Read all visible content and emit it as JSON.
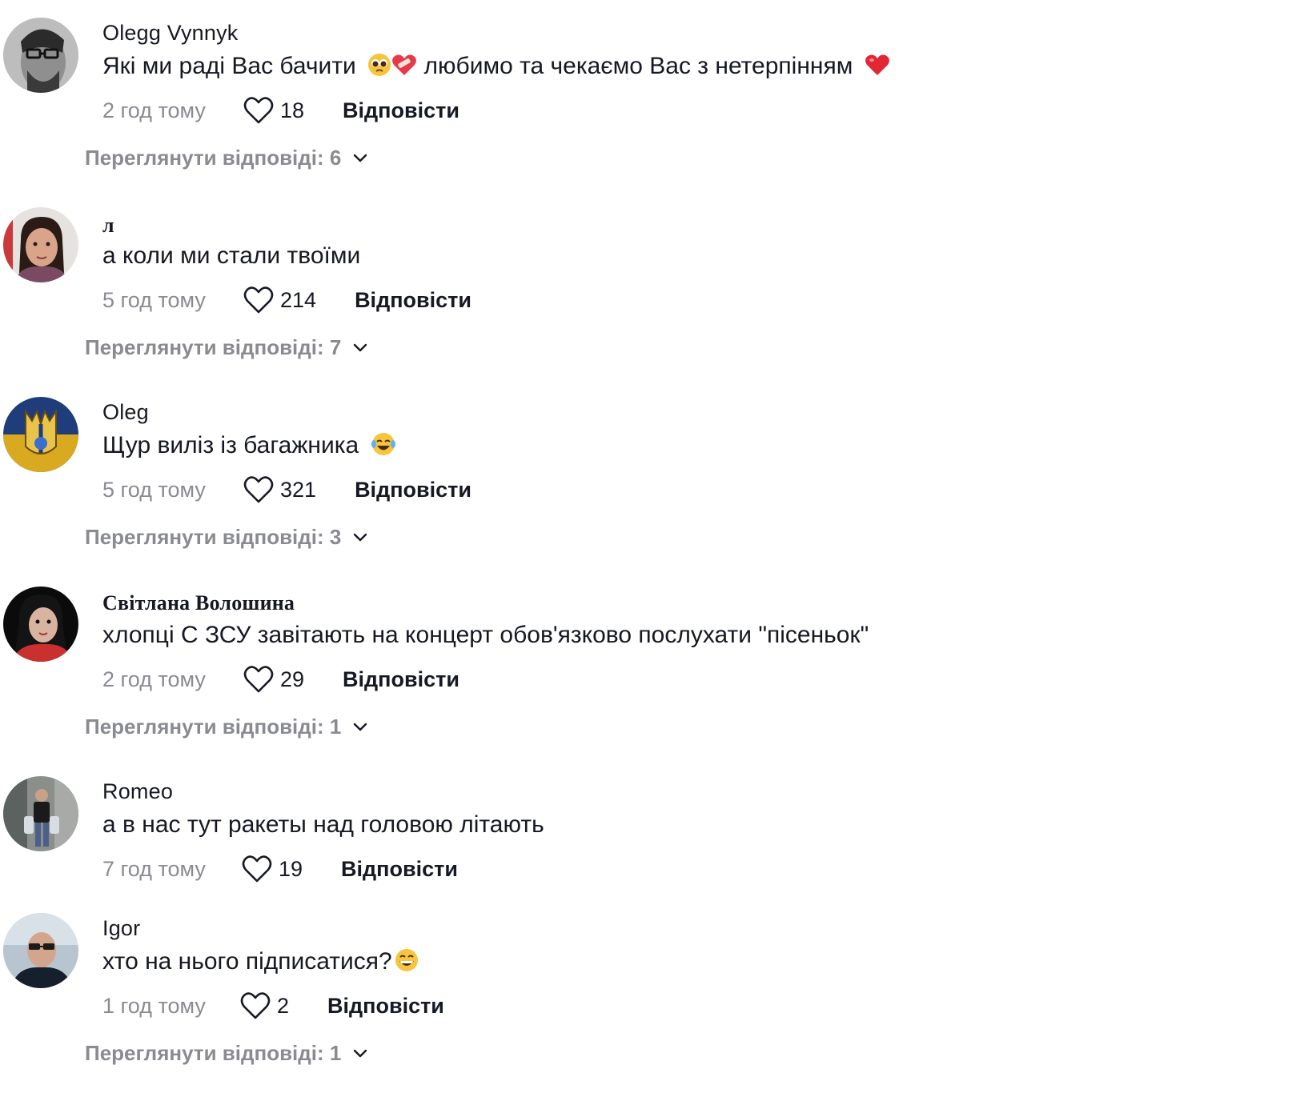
{
  "colors": {
    "text_primary": "#161823",
    "text_secondary": "#8a8b91",
    "heart_outline": "#161823",
    "background": "#ffffff"
  },
  "icons": {
    "like": "heart-outline-icon",
    "expand": "chevron-down-icon"
  },
  "comments": [
    {
      "username": "Olegg Vynnyk",
      "text": "Які ми раді Вас бачити",
      "text_after": "любимо та чекаємо Вас з нетерпінням",
      "emojis": [
        "pleading-face-emoji",
        "mending-heart-emoji",
        "red-heart-emoji"
      ],
      "time": "2 год тому",
      "likes": "18",
      "reply_label": "Відповісти",
      "view_replies": "Переглянути відповіді: 6"
    },
    {
      "username": "л",
      "text": "а коли ми стали твоїми",
      "time": "5 год тому",
      "likes": "214",
      "reply_label": "Відповісти",
      "view_replies": "Переглянути відповіді: 7"
    },
    {
      "username": "Oleg",
      "text": "Щур виліз із багажника",
      "emojis": [
        "tears-of-joy-emoji"
      ],
      "time": "5 год тому",
      "likes": "321",
      "reply_label": "Відповісти",
      "view_replies": "Переглянути відповіді: 3"
    },
    {
      "username": "Світлана Волошина",
      "text": "хлопці С ЗСУ завітають на концерт обов'язково послухати \"пісеньок\"",
      "time": "2 год тому",
      "likes": "29",
      "reply_label": "Відповісти",
      "view_replies": "Переглянути відповіді: 1"
    },
    {
      "username": "Romeo",
      "text": "а в нас тут ракеты над головою літають",
      "time": "7 год тому",
      "likes": "19",
      "reply_label": "Відповісти"
    },
    {
      "username": "Igor",
      "text": "хто на нього підписатися?",
      "emojis": [
        "grinning-face-emoji"
      ],
      "time": "1 год тому",
      "likes": "2",
      "reply_label": "Відповісти",
      "view_replies": "Переглянути відповіді: 1"
    }
  ]
}
